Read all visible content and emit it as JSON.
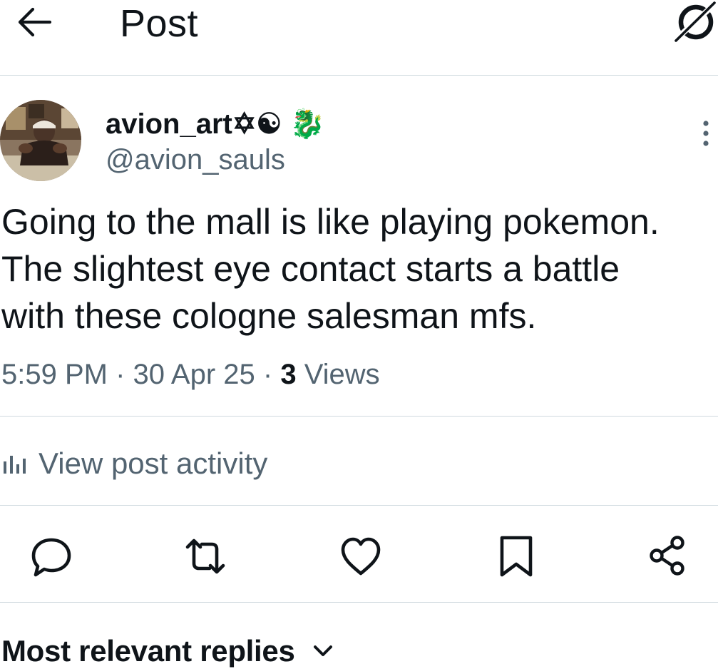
{
  "header": {
    "title": "Post",
    "back_icon": "arrow-left-icon",
    "right_icon": "grok-icon"
  },
  "author": {
    "display_name": "avion_art✡☯ 🐉",
    "handle": "@avion_sauls",
    "more_icon": "more-vertical-icon"
  },
  "tweet": {
    "lines": [
      "Going to the mall is like playing pokemon.",
      "The slightest eye contact starts a battle",
      "with these cologne salesman mfs."
    ],
    "time": "5:59 PM",
    "date": "30 Apr 25",
    "separator": " · ",
    "views_count": "3",
    "views_label": "Views"
  },
  "activity": {
    "label": "View post activity",
    "icon": "bar-chart-icon"
  },
  "actions": [
    {
      "name": "reply",
      "icon": "reply-icon"
    },
    {
      "name": "repost",
      "icon": "repost-icon"
    },
    {
      "name": "like",
      "icon": "heart-icon"
    },
    {
      "name": "bookmark",
      "icon": "bookmark-icon"
    },
    {
      "name": "share",
      "icon": "share-icon"
    }
  ],
  "replies": {
    "label": "Most relevant replies",
    "icon": "chevron-down-icon"
  },
  "colors": {
    "text_primary": "#0f1419",
    "text_secondary": "#536471",
    "divider": "#cfd9de"
  }
}
